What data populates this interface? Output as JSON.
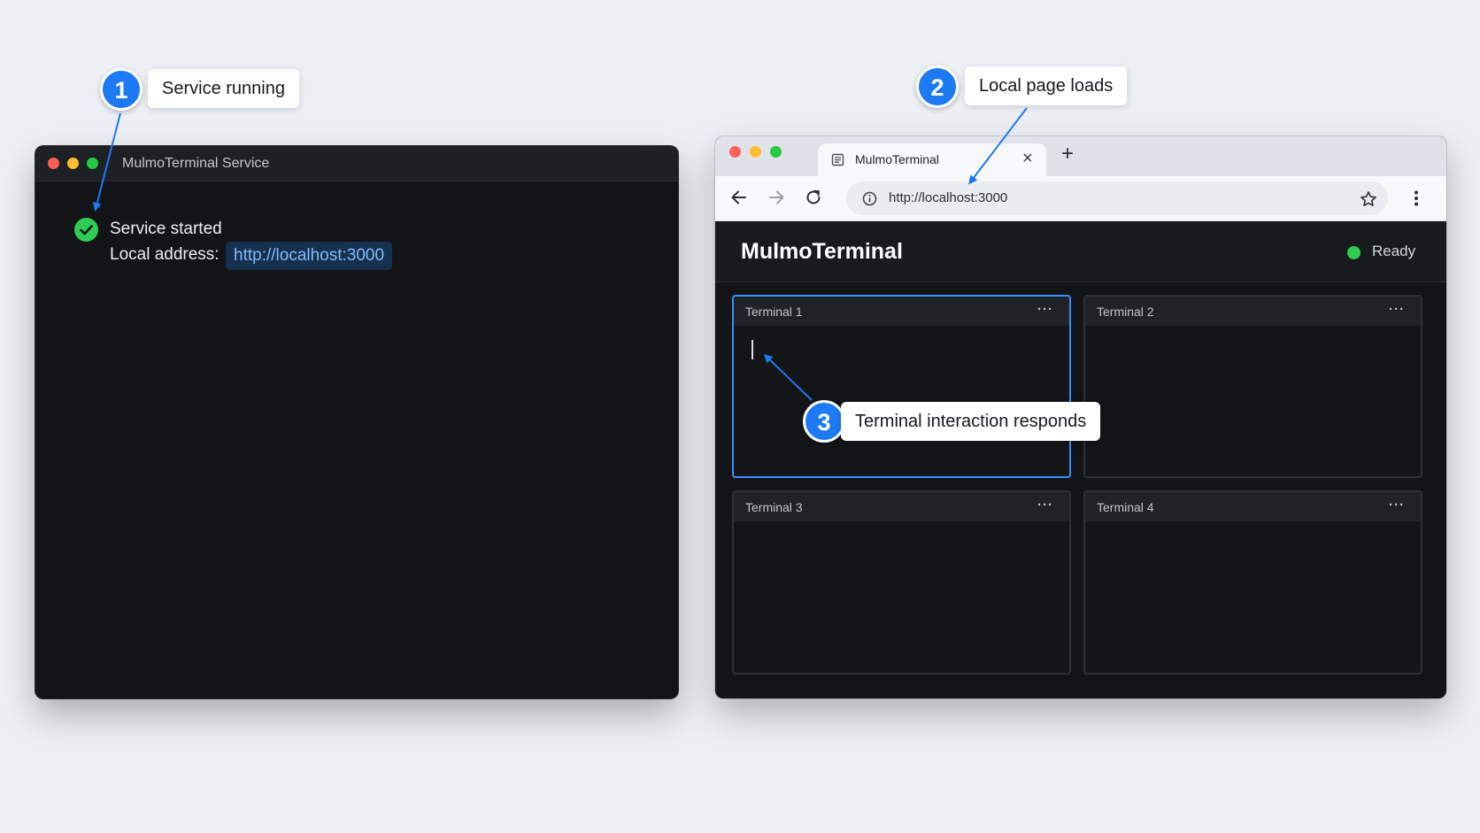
{
  "terminal_window": {
    "title": "MulmoTerminal Service",
    "status_text": "Service started",
    "address_label": "Local address:",
    "address_link": "http://localhost:3000"
  },
  "browser": {
    "tab_title": "MulmoTerminal",
    "tab_close": "×",
    "new_tab": "+",
    "url": "http://localhost:3000",
    "app": {
      "title": "MulmoTerminal",
      "status": "Ready",
      "status_color": "#2ecc52",
      "panes": [
        {
          "title": "Terminal 1",
          "menu": "···",
          "active": true
        },
        {
          "title": "Terminal 2",
          "menu": "···",
          "active": false
        },
        {
          "title": "Terminal 3",
          "menu": "···",
          "active": false
        },
        {
          "title": "Terminal 4",
          "menu": "···",
          "active": false
        }
      ]
    }
  },
  "annotations": [
    {
      "number": "1",
      "label": "Service running"
    },
    {
      "number": "2",
      "label": "Local page loads"
    },
    {
      "number": "3",
      "label": "Terminal interaction responds"
    }
  ],
  "colors": {
    "accent": "#1d7af3",
    "success": "#2ecc52",
    "link": "#7fbdfb",
    "traffic_red": "#fe5f57",
    "traffic_yellow": "#febc2e",
    "traffic_green": "#28c840"
  },
  "icons": [
    "check-icon",
    "document-icon",
    "back-arrow-icon",
    "forward-arrow-icon",
    "reload-icon",
    "info-icon",
    "star-icon",
    "more-vertical-icon",
    "more-horizontal-icon"
  ]
}
